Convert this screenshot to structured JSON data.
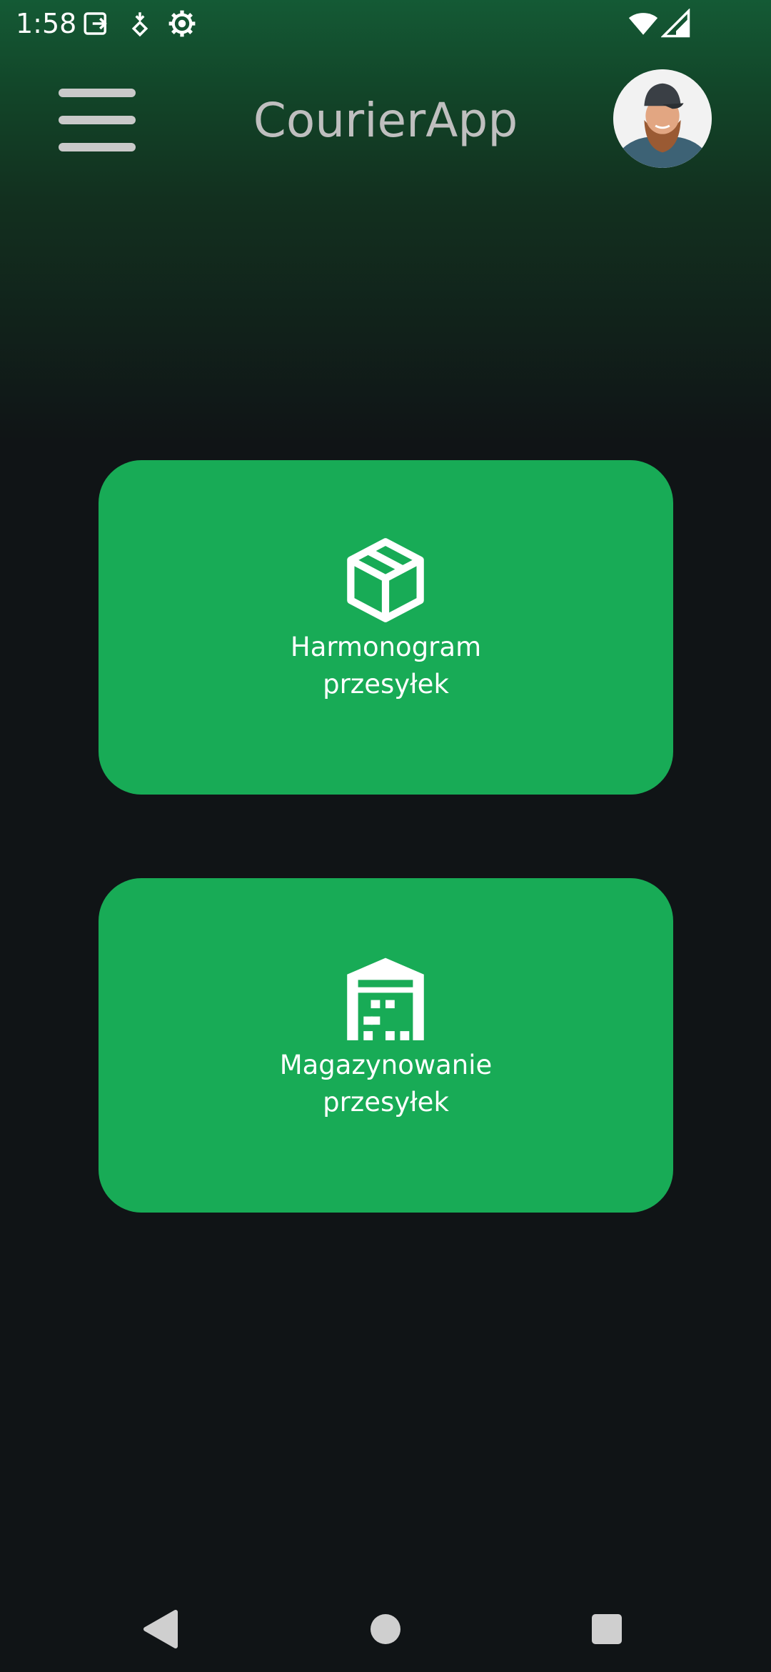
{
  "status_bar": {
    "time": "1:58",
    "icons": [
      "screen-share-icon",
      "location-pin-icon",
      "settings-gear-icon",
      "wifi-icon",
      "cellular-signal-icon"
    ]
  },
  "app_bar": {
    "title": "CourierApp",
    "menu_icon": "hamburger-menu-icon",
    "avatar": "user-avatar"
  },
  "cards": [
    {
      "icon": "package-box-icon",
      "label_line1": "Harmonogram",
      "label_line2": "przesyłek"
    },
    {
      "icon": "warehouse-icon",
      "label_line1": "Magazynowanie",
      "label_line2": "przesyłek"
    }
  ],
  "nav_bar": {
    "buttons": [
      "back-icon",
      "home-icon",
      "recents-icon"
    ]
  },
  "colors": {
    "accent": "#18ab56",
    "background": "#101416",
    "header_gradient": "#145a35",
    "title_text": "#bfbfbf"
  }
}
